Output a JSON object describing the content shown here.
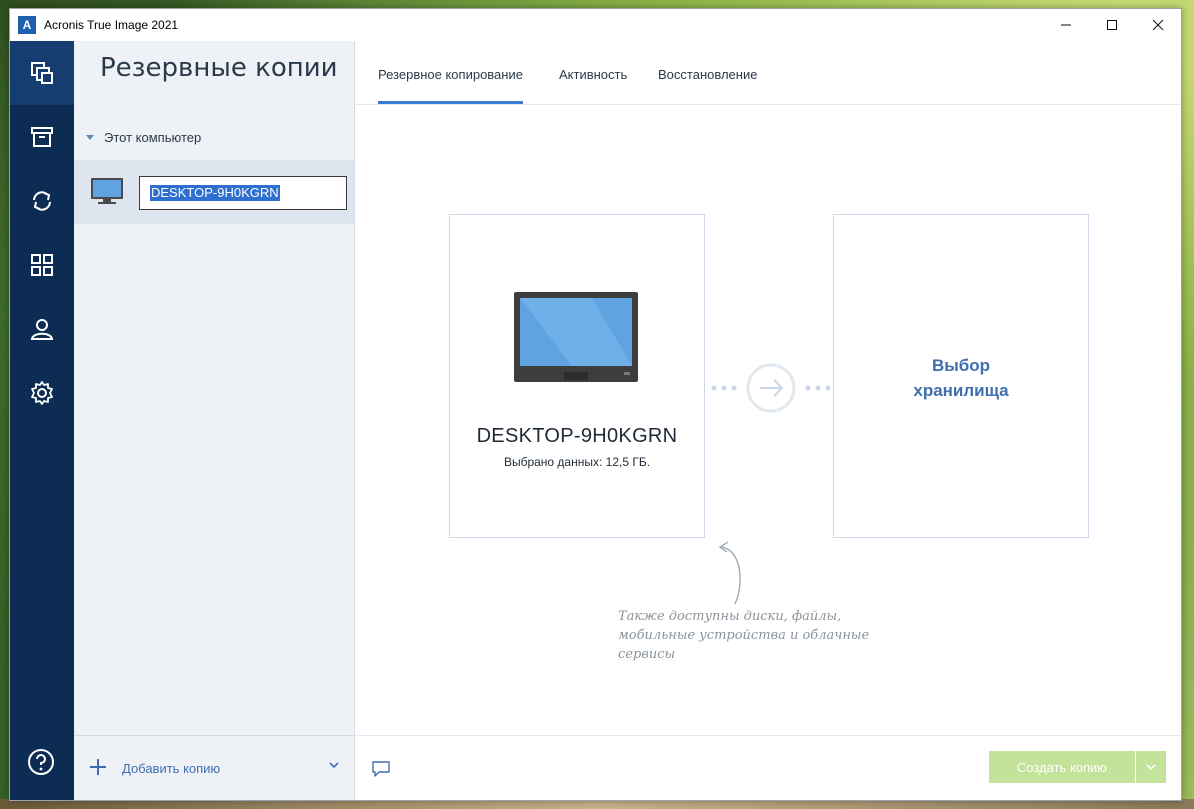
{
  "window": {
    "title": "Acronis True Image 2021",
    "logo_letter": "A",
    "controls": [
      "minimize-icon",
      "maximize-icon",
      "close-icon"
    ]
  },
  "rail": {
    "items": [
      {
        "name": "backup",
        "icon": "copies-icon",
        "active": true
      },
      {
        "name": "archive",
        "icon": "archive-icon",
        "active": false
      },
      {
        "name": "sync",
        "icon": "sync-icon",
        "active": false
      },
      {
        "name": "tools",
        "icon": "grid-icon",
        "active": false
      },
      {
        "name": "account",
        "icon": "user-icon",
        "active": false
      },
      {
        "name": "settings",
        "icon": "gear-icon",
        "active": false
      }
    ],
    "help_icon": "help-icon"
  },
  "panel": {
    "title": "Резервные копии",
    "group_label": "Этот компьютер",
    "backup_name_value": "DESKTOP-9H0KGRN",
    "add_label": "Добавить копию"
  },
  "tabs": [
    {
      "label": "Резервное копирование",
      "active": true
    },
    {
      "label": "Активность",
      "active": false
    },
    {
      "label": "Восстановление",
      "active": false
    }
  ],
  "source": {
    "name": "DESKTOP-9H0KGRN",
    "selected": "Выбрано данных: 12,5 ГБ."
  },
  "destination": {
    "label": "Выбор хранилища"
  },
  "hint": "Также доступны диски, файлы, мобильные устройства и облачные сервисы",
  "footer": {
    "create_label": "Создать копию"
  },
  "colors": {
    "rail_bg": "#0d2c54",
    "accent": "#3a7bd5",
    "create_button": "#c3e29a"
  }
}
